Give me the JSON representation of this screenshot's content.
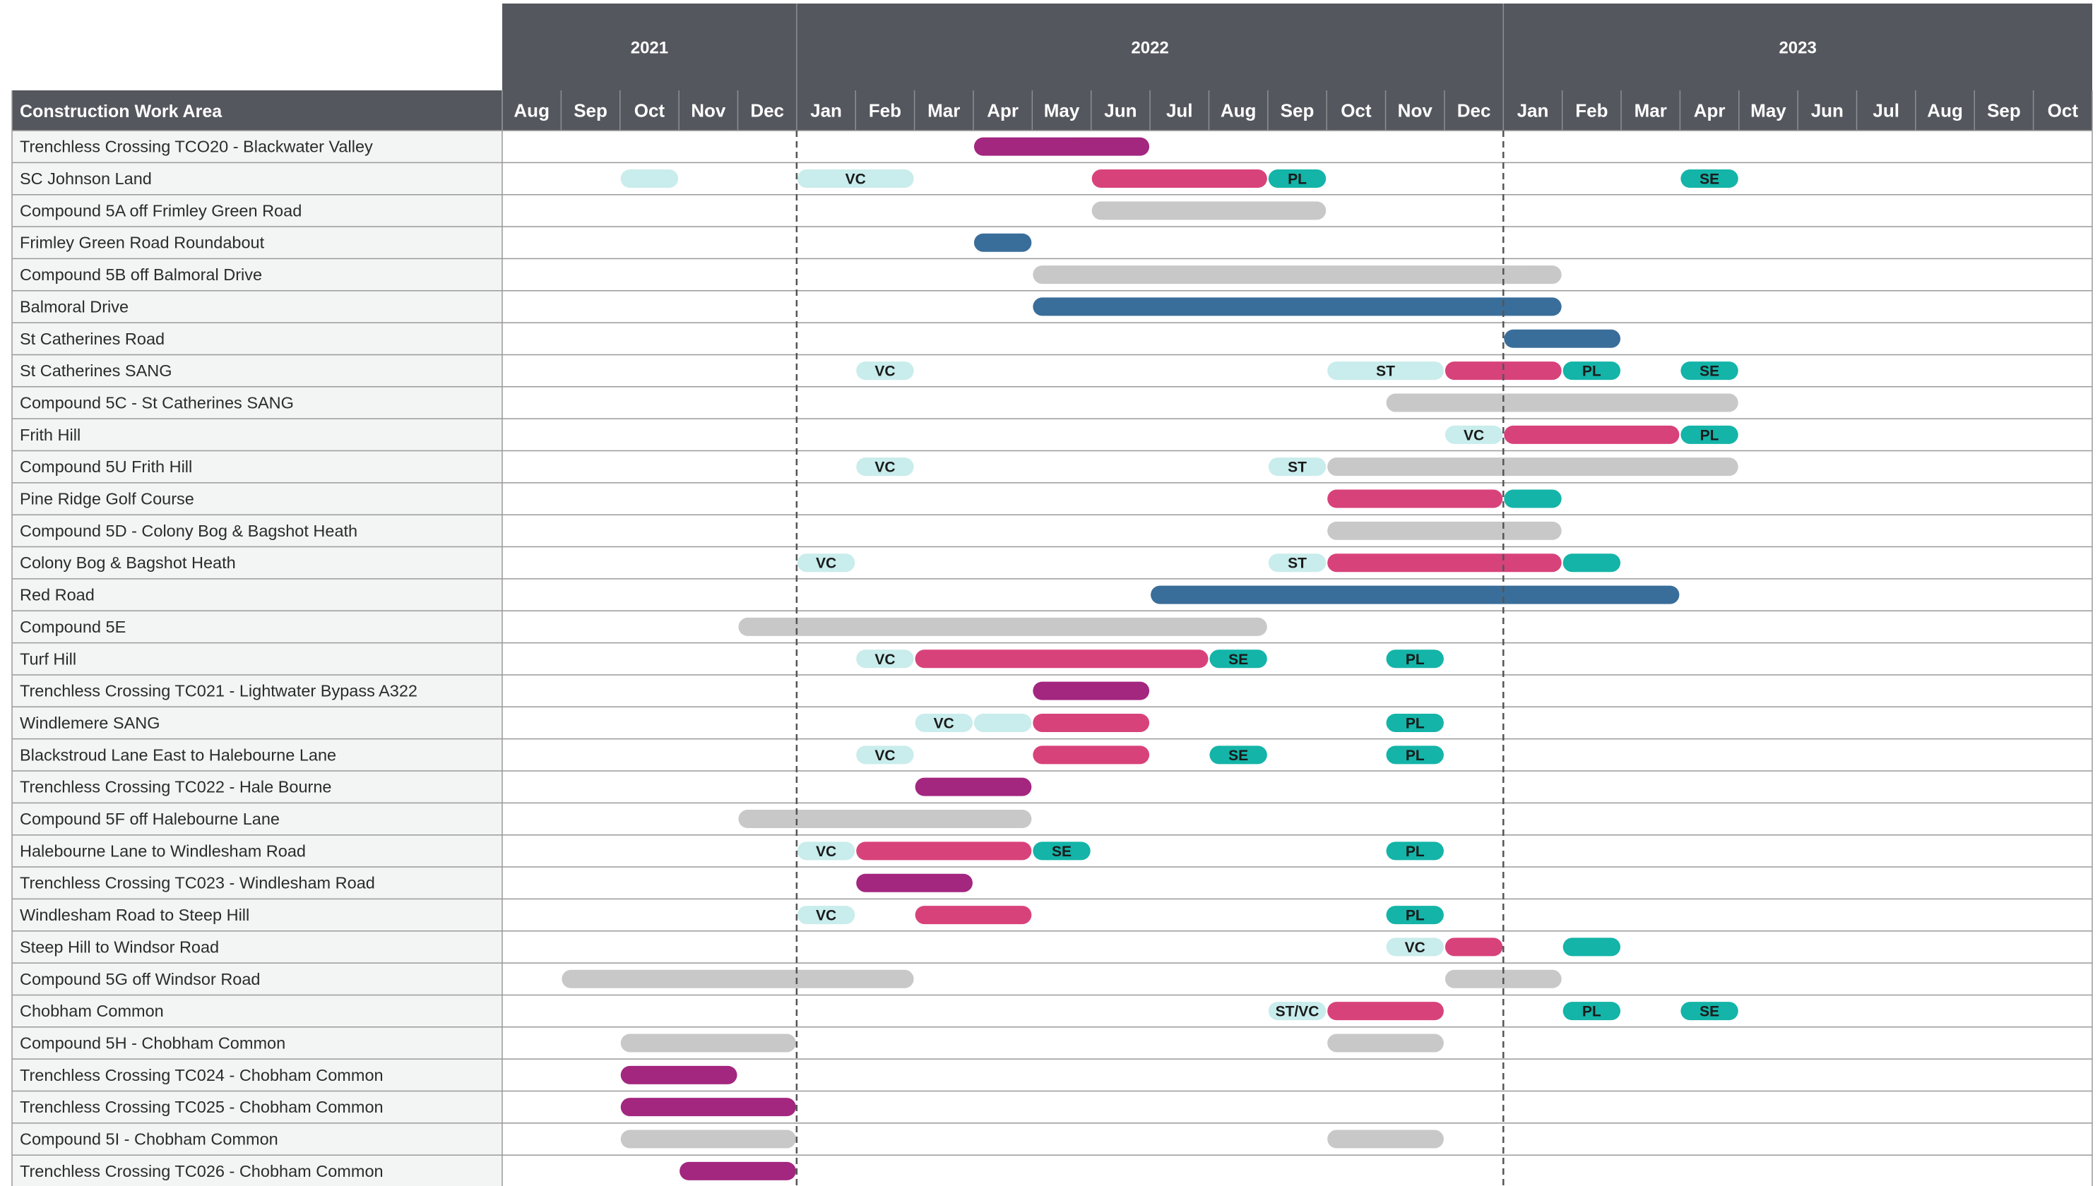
{
  "chart_data": {
    "type": "gantt",
    "title": "",
    "column_header": "Construction Work Area",
    "years": [
      {
        "label": "2021",
        "start": "2021-08",
        "end": "2021-12"
      },
      {
        "label": "2022",
        "start": "2022-01",
        "end": "2022-12"
      },
      {
        "label": "2023",
        "start": "2023-01",
        "end": "2023-10"
      }
    ],
    "months": [
      "Aug",
      "Sep",
      "Oct",
      "Nov",
      "Dec",
      "Jan",
      "Feb",
      "Mar",
      "Apr",
      "May",
      "Jun",
      "Jul",
      "Aug",
      "Sep",
      "Oct",
      "Nov",
      "Dec",
      "Jan",
      "Feb",
      "Mar",
      "Apr",
      "May",
      "Jun",
      "Jul",
      "Aug",
      "Sep",
      "Oct"
    ],
    "month_range": [
      "2021-08",
      "2023-10"
    ],
    "year_dividers": [
      "2022-01",
      "2023-01"
    ],
    "colors": {
      "purple": "#a3267f",
      "pink": "#d8427a",
      "teal": "#14b4a8",
      "lightteal": "#c9ecec",
      "grey": "#c8c8c8",
      "blue": "#3a6e9a",
      "header": "#54575d"
    },
    "rows": [
      {
        "label": "Trenchless Crossing TCO20 - Blackwater Valley",
        "bars": [
          {
            "start": "2022-04",
            "end": "2022-06",
            "color": "purple"
          }
        ]
      },
      {
        "label": "SC Johnson Land",
        "bars": [
          {
            "start": "2021-10",
            "end": "2021-10",
            "color": "lightteal"
          },
          {
            "start": "2022-01",
            "end": "2022-02",
            "color": "lightteal",
            "text": "VC"
          },
          {
            "start": "2022-06",
            "end": "2022-08",
            "color": "pink"
          },
          {
            "start": "2022-09",
            "end": "2022-09",
            "color": "teal",
            "text": "PL"
          },
          {
            "start": "2023-04",
            "end": "2023-04",
            "color": "teal",
            "text": "SE"
          }
        ]
      },
      {
        "label": "Compound 5A off Frimley Green Road",
        "bars": [
          {
            "start": "2022-06",
            "end": "2022-09",
            "color": "grey"
          }
        ]
      },
      {
        "label": "Frimley Green Road Roundabout",
        "bars": [
          {
            "start": "2022-04",
            "end": "2022-04",
            "color": "blue"
          }
        ]
      },
      {
        "label": "Compound 5B off Balmoral Drive",
        "bars": [
          {
            "start": "2022-05",
            "end": "2023-01",
            "color": "grey"
          }
        ]
      },
      {
        "label": "Balmoral Drive",
        "bars": [
          {
            "start": "2022-05",
            "end": "2023-01",
            "color": "blue"
          }
        ]
      },
      {
        "label": "St Catherines Road",
        "bars": [
          {
            "start": "2023-01",
            "end": "2023-02",
            "color": "blue"
          }
        ]
      },
      {
        "label": "St Catherines SANG",
        "bars": [
          {
            "start": "2022-02",
            "end": "2022-02",
            "color": "lightteal",
            "text": "VC"
          },
          {
            "start": "2022-10",
            "end": "2022-11",
            "color": "lightteal",
            "text": "ST"
          },
          {
            "start": "2022-12",
            "end": "2023-01",
            "color": "pink"
          },
          {
            "start": "2023-02",
            "end": "2023-02",
            "color": "teal",
            "text": "PL"
          },
          {
            "start": "2023-04",
            "end": "2023-04",
            "color": "teal",
            "text": "SE"
          }
        ]
      },
      {
        "label": "Compound 5C - St Catherines SANG",
        "bars": [
          {
            "start": "2022-11",
            "end": "2023-04",
            "color": "grey"
          }
        ]
      },
      {
        "label": "Frith Hill",
        "bars": [
          {
            "start": "2022-12",
            "end": "2022-12",
            "color": "lightteal",
            "text": "VC"
          },
          {
            "start": "2023-01",
            "end": "2023-03",
            "color": "pink"
          },
          {
            "start": "2023-04",
            "end": "2023-04",
            "color": "teal",
            "text": "PL"
          }
        ]
      },
      {
        "label": "Compound 5U Frith Hill",
        "bars": [
          {
            "start": "2022-02",
            "end": "2022-02",
            "color": "lightteal",
            "text": "VC"
          },
          {
            "start": "2022-09",
            "end": "2022-09",
            "color": "lightteal",
            "text": "ST"
          },
          {
            "start": "2022-10",
            "end": "2023-04",
            "color": "grey"
          }
        ]
      },
      {
        "label": "Pine Ridge Golf Course",
        "bars": [
          {
            "start": "2022-10",
            "end": "2022-12",
            "color": "pink"
          },
          {
            "start": "2023-01",
            "end": "2023-01",
            "color": "teal"
          }
        ]
      },
      {
        "label": "Compound 5D - Colony Bog & Bagshot Heath",
        "bars": [
          {
            "start": "2022-10",
            "end": "2023-01",
            "color": "grey"
          }
        ]
      },
      {
        "label": "Colony Bog & Bagshot Heath",
        "bars": [
          {
            "start": "2022-01",
            "end": "2022-01",
            "color": "lightteal",
            "text": "VC"
          },
          {
            "start": "2022-09",
            "end": "2022-09",
            "color": "lightteal",
            "text": "ST"
          },
          {
            "start": "2022-10",
            "end": "2023-01",
            "color": "pink"
          },
          {
            "start": "2023-02",
            "end": "2023-02",
            "color": "teal"
          }
        ]
      },
      {
        "label": "Red Road",
        "bars": [
          {
            "start": "2022-07",
            "end": "2023-03",
            "color": "blue"
          }
        ]
      },
      {
        "label": "Compound 5E",
        "bars": [
          {
            "start": "2021-12",
            "end": "2022-08",
            "color": "grey"
          }
        ]
      },
      {
        "label": "Turf Hill",
        "bars": [
          {
            "start": "2022-02",
            "end": "2022-02",
            "color": "lightteal",
            "text": "VC"
          },
          {
            "start": "2022-03",
            "end": "2022-07",
            "color": "pink"
          },
          {
            "start": "2022-08",
            "end": "2022-08",
            "color": "teal",
            "text": "SE"
          },
          {
            "start": "2022-11",
            "end": "2022-11",
            "color": "teal",
            "text": "PL"
          }
        ]
      },
      {
        "label": "Trenchless Crossing TC021 - Lightwater Bypass A322",
        "bars": [
          {
            "start": "2022-05",
            "end": "2022-06",
            "color": "purple"
          }
        ]
      },
      {
        "label": "Windlemere SANG",
        "bars": [
          {
            "start": "2022-03",
            "end": "2022-03",
            "color": "lightteal",
            "text": "VC"
          },
          {
            "start": "2022-04",
            "end": "2022-04",
            "color": "lightteal"
          },
          {
            "start": "2022-05",
            "end": "2022-06",
            "color": "pink"
          },
          {
            "start": "2022-11",
            "end": "2022-11",
            "color": "teal",
            "text": "PL"
          }
        ]
      },
      {
        "label": "Blackstroud Lane East to Halebourne Lane",
        "bars": [
          {
            "start": "2022-02",
            "end": "2022-02",
            "color": "lightteal",
            "text": "VC"
          },
          {
            "start": "2022-05",
            "end": "2022-06",
            "color": "pink"
          },
          {
            "start": "2022-08",
            "end": "2022-08",
            "color": "teal",
            "text": "SE"
          },
          {
            "start": "2022-11",
            "end": "2022-11",
            "color": "teal",
            "text": "PL"
          }
        ]
      },
      {
        "label": "Trenchless Crossing TC022 - Hale Bourne",
        "bars": [
          {
            "start": "2022-03",
            "end": "2022-04",
            "color": "purple"
          }
        ]
      },
      {
        "label": "Compound 5F off Halebourne Lane",
        "bars": [
          {
            "start": "2021-12",
            "end": "2022-04",
            "color": "grey"
          }
        ]
      },
      {
        "label": "Halebourne Lane to Windlesham Road",
        "bars": [
          {
            "start": "2022-01",
            "end": "2022-01",
            "color": "lightteal",
            "text": "VC"
          },
          {
            "start": "2022-02",
            "end": "2022-04",
            "color": "pink"
          },
          {
            "start": "2022-05",
            "end": "2022-05",
            "color": "teal",
            "text": "SE"
          },
          {
            "start": "2022-11",
            "end": "2022-11",
            "color": "teal",
            "text": "PL"
          }
        ]
      },
      {
        "label": "Trenchless Crossing TC023 - Windlesham Road",
        "bars": [
          {
            "start": "2022-02",
            "end": "2022-03",
            "color": "purple"
          }
        ]
      },
      {
        "label": "Windlesham Road to Steep Hill",
        "bars": [
          {
            "start": "2022-01",
            "end": "2022-01",
            "color": "lightteal",
            "text": "VC"
          },
          {
            "start": "2022-03",
            "end": "2022-04",
            "color": "pink"
          },
          {
            "start": "2022-11",
            "end": "2022-11",
            "color": "teal",
            "text": "PL"
          }
        ]
      },
      {
        "label": "Steep Hill to Windsor Road",
        "bars": [
          {
            "start": "2022-11",
            "end": "2022-11",
            "color": "lightteal",
            "text": "VC"
          },
          {
            "start": "2022-12",
            "end": "2022-12",
            "color": "pink"
          },
          {
            "start": "2023-02",
            "end": "2023-02",
            "color": "teal"
          }
        ]
      },
      {
        "label": "Compound 5G off Windsor Road",
        "bars": [
          {
            "start": "2021-09",
            "end": "2022-02",
            "color": "grey"
          },
          {
            "start": "2022-12",
            "end": "2023-01",
            "color": "grey"
          }
        ]
      },
      {
        "label": "Chobham Common",
        "bars": [
          {
            "start": "2022-09",
            "end": "2022-09",
            "color": "lightteal",
            "text": "ST/VC"
          },
          {
            "start": "2022-10",
            "end": "2022-11",
            "color": "pink"
          },
          {
            "start": "2023-02",
            "end": "2023-02",
            "color": "teal",
            "text": "PL"
          },
          {
            "start": "2023-04",
            "end": "2023-04",
            "color": "teal",
            "text": "SE"
          }
        ]
      },
      {
        "label": "Compound 5H - Chobham Common",
        "bars": [
          {
            "start": "2021-10",
            "end": "2021-12",
            "color": "grey"
          },
          {
            "start": "2022-10",
            "end": "2022-11",
            "color": "grey"
          }
        ]
      },
      {
        "label": "Trenchless Crossing TC024 - Chobham Common",
        "bars": [
          {
            "start": "2021-10",
            "end": "2021-11",
            "color": "purple"
          }
        ]
      },
      {
        "label": "Trenchless Crossing TC025 - Chobham Common",
        "bars": [
          {
            "start": "2021-10",
            "end": "2021-12",
            "color": "purple"
          }
        ]
      },
      {
        "label": "Compound 5I - Chobham Common",
        "bars": [
          {
            "start": "2021-10",
            "end": "2021-12",
            "color": "grey"
          },
          {
            "start": "2022-10",
            "end": "2022-11",
            "color": "grey"
          }
        ]
      },
      {
        "label": "Trenchless Crossing TC026 - Chobham Common",
        "bars": [
          {
            "start": "2021-11",
            "end": "2021-12",
            "color": "purple"
          }
        ]
      }
    ]
  }
}
